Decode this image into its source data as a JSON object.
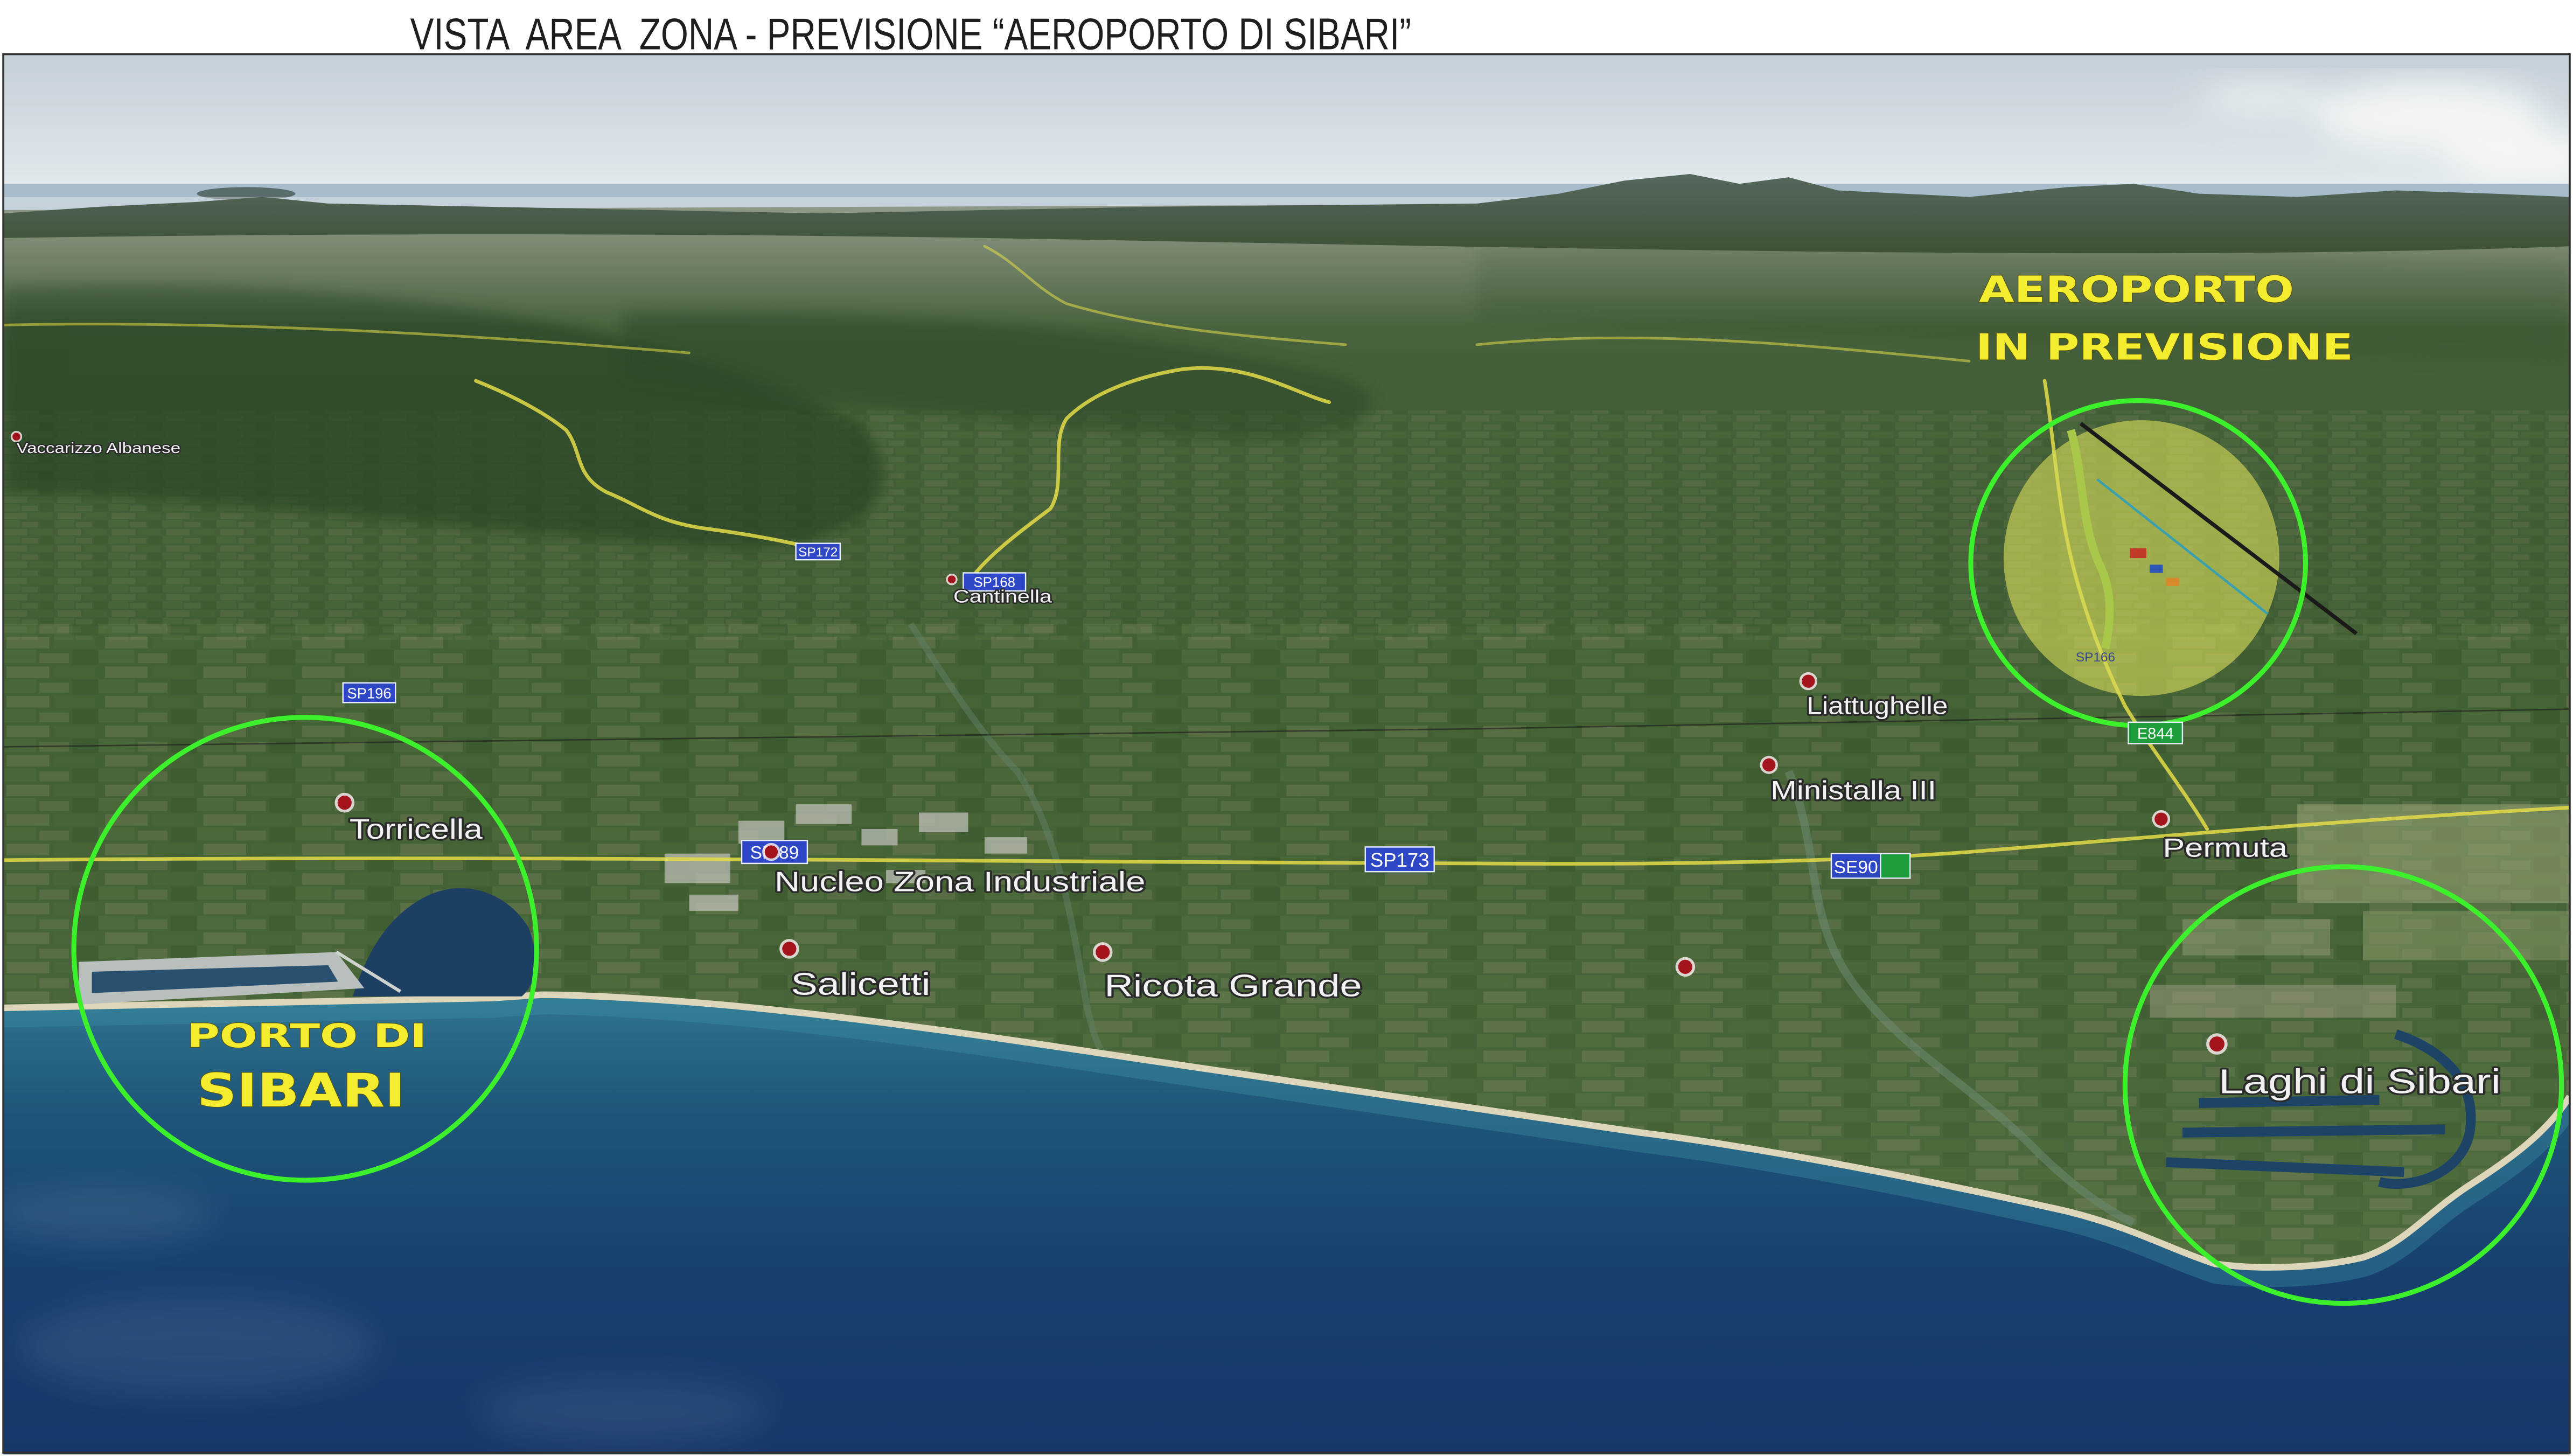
{
  "title": "VISTA  AREA  ZONA - PREVISIONE “AEROPORTO DI SIBARI”",
  "annotations": {
    "airport": [
      "AEROPORTO",
      "IN PREVISIONE"
    ],
    "port": [
      "PORTO DI",
      "SIBARI"
    ]
  },
  "places": [
    {
      "name": "Vaccarizzo Albanese"
    },
    {
      "name": "Cantinella"
    },
    {
      "name": "Torricella"
    },
    {
      "name": "Nucleo Zona Industriale"
    },
    {
      "name": "Salicetti"
    },
    {
      "name": "Ricota Grande"
    },
    {
      "name": "Liattughelle"
    },
    {
      "name": "Ministalla III"
    },
    {
      "name": "Permuta"
    },
    {
      "name": "Laghi di Sibari"
    }
  ],
  "roads": [
    {
      "label": "SP172"
    },
    {
      "label": "SP168"
    },
    {
      "label": "SP196"
    },
    {
      "label": "SP 89"
    },
    {
      "label": "SP173"
    },
    {
      "label": "SE90"
    },
    {
      "label": "E844"
    },
    {
      "label": "SP166"
    }
  ],
  "icons": {
    "place_marker": "red-dot-marker-icon",
    "road_shield": "road-shield-icon"
  },
  "colors": {
    "circle_green": "#3df02c",
    "annotation_yellow": "#f4ec2f",
    "label_white": "#f2f2f2",
    "shield_blue": "#2d47c7",
    "shield_green": "#1d9e3a",
    "marker_red": "#a3141d"
  }
}
